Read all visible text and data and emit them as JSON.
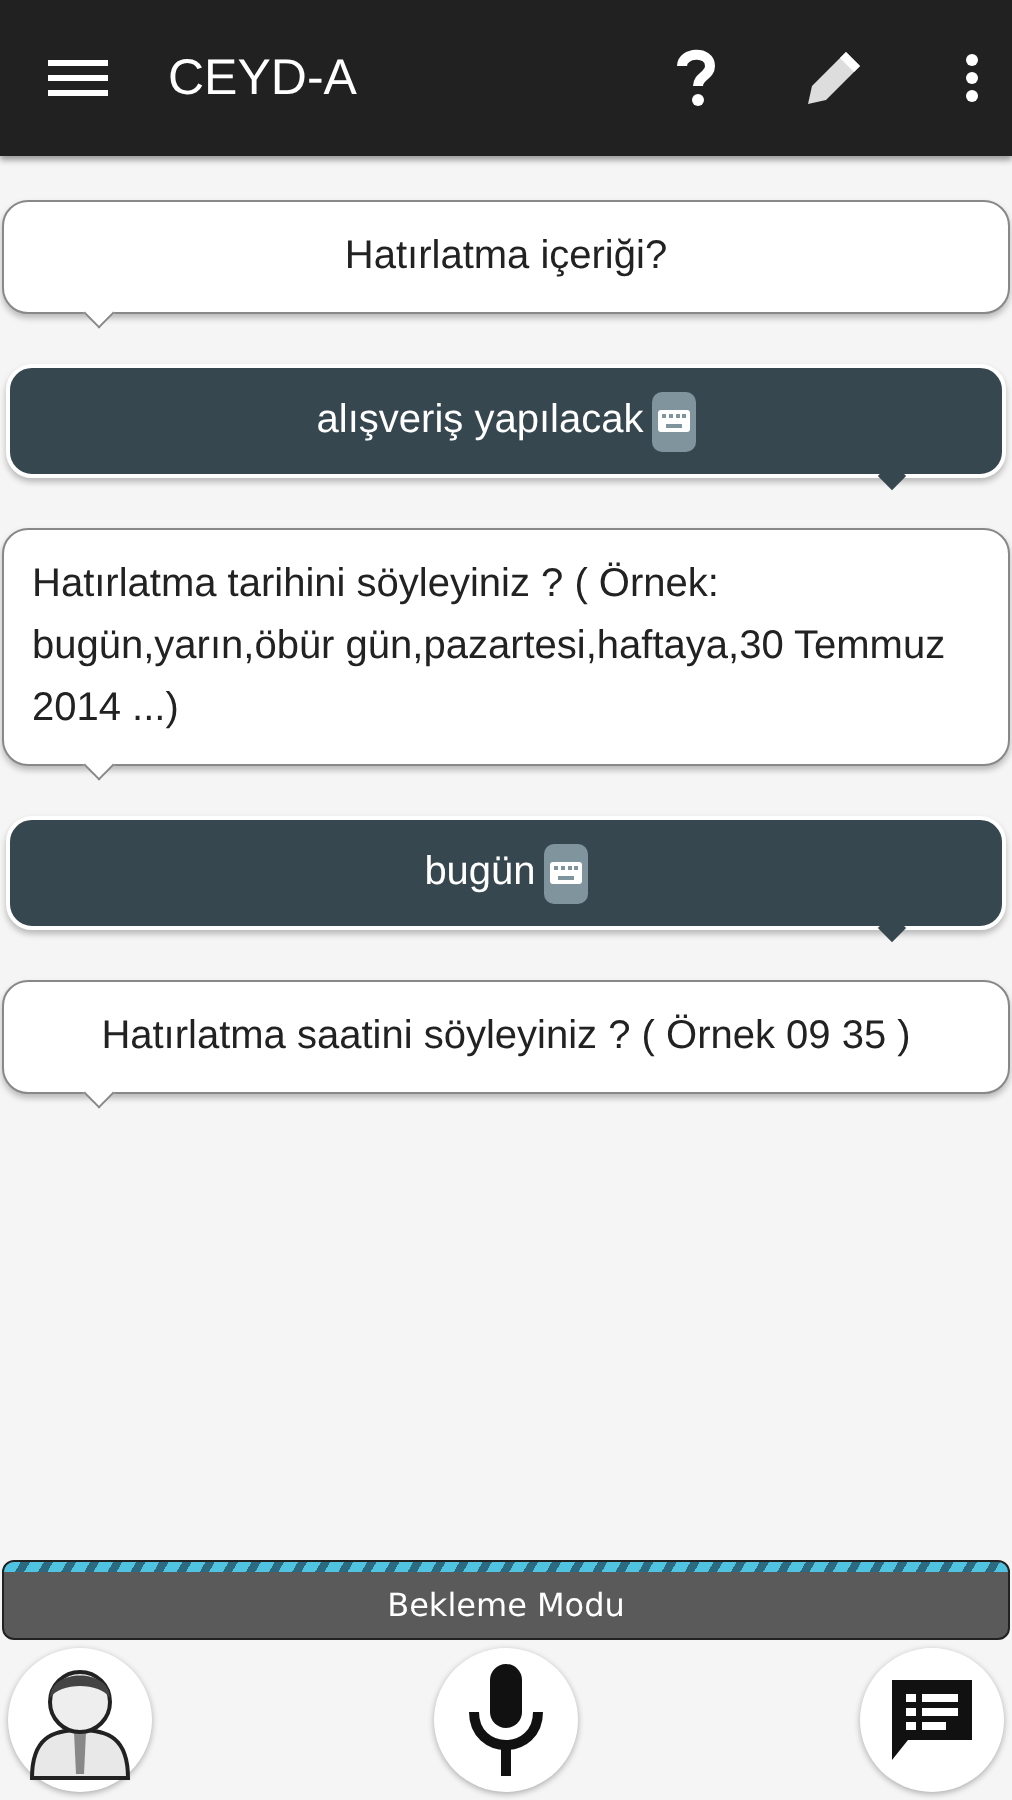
{
  "app_bar": {
    "title": "CEYD-A"
  },
  "messages": [
    {
      "kind": "assistant",
      "text": "Hatırlatma içeriği?"
    },
    {
      "kind": "user",
      "text": "alışveriş yapılacak"
    },
    {
      "kind": "assistant",
      "text": "Hatırlatma tarihini söyleyiniz ? ( Örnek: bugün,yarın,öbür gün,pazartesi,haftaya,30 Temmuz 2014 ...)"
    },
    {
      "kind": "user",
      "text": "bugün"
    },
    {
      "kind": "assistant",
      "text": "Hatırlatma saatini söyleyiniz ? ( Örnek 09 35 )"
    }
  ],
  "status_bar": {
    "text": "Bekleme Modu"
  }
}
